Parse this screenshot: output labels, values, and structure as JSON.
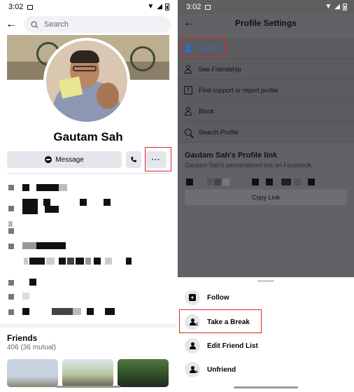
{
  "left": {
    "status_time": "3:02",
    "search_placeholder": "Search",
    "profile_name": "Gautam Sah",
    "message_label": "Message",
    "more_label": "···",
    "friends_title": "Friends",
    "friends_count": "406 (36 mutual)"
  },
  "right": {
    "status_time": "3:02",
    "title": "Profile Settings",
    "menu": [
      {
        "label": "Friends",
        "icon": "friends-icon"
      },
      {
        "label": "See Friendship",
        "icon": "see-friendship-icon"
      },
      {
        "label": "Find support or report profile",
        "icon": "report-icon"
      },
      {
        "label": "Block",
        "icon": "block-icon"
      },
      {
        "label": "Search Profile",
        "icon": "search-icon"
      }
    ],
    "link_title": "Gautam Sah's Profile link",
    "link_subtitle": "Gautam Sah's personalized link on Facebook.",
    "copy_link_label": "Copy Link",
    "sheet": [
      {
        "label": "Follow",
        "icon": "follow-icon"
      },
      {
        "label": "Take a Break",
        "icon": "take-a-break-icon"
      },
      {
        "label": "Edit Friend List",
        "icon": "edit-friend-list-icon"
      },
      {
        "label": "Unfriend",
        "icon": "unfriend-icon"
      }
    ]
  },
  "colors": {
    "highlight": "#d52b2b",
    "facebook_blue": "#2d6bd6",
    "dim_overlay": "#626266"
  }
}
